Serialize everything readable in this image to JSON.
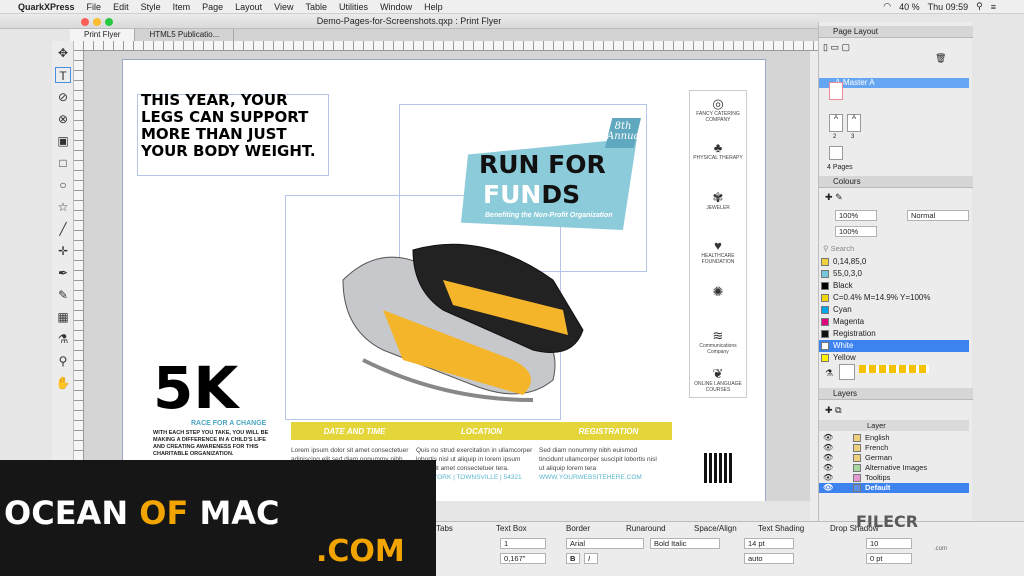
{
  "menubar": {
    "apple": "",
    "app": "QuarkXPress",
    "items": [
      "File",
      "Edit",
      "Style",
      "Item",
      "Page",
      "Layout",
      "View",
      "Table",
      "Utilities",
      "Window",
      "Help"
    ],
    "battery": "40 %",
    "clock": "Thu 09:59"
  },
  "window": {
    "title": "Demo-Pages-for-Screenshots.qxp : Print Flyer"
  },
  "tabs": [
    "Print Flyer",
    "HTML5 Publicatio..."
  ],
  "tools": [
    "move-icon",
    "text-content-icon",
    "text-linking-icon",
    "text-unlinking-icon",
    "picture-content-icon",
    "rectangle-box-icon",
    "oval-box-icon",
    "star-box-icon",
    "line-icon",
    "orthogonal-line-icon",
    "pen-icon",
    "pencil-icon",
    "table-icon",
    "eyedropper-icon",
    "zoom-icon",
    "pan-hand-icon"
  ],
  "flyer": {
    "headline": "THIS YEAR, YOUR\nLEGS CAN SUPPORT\nMORE THAN JUST\nYOUR BODY WEIGHT.",
    "eighth_line1": "8th",
    "eighth_line2": "Annual",
    "run_line1": "RUN FOR",
    "run_fun": "FUN",
    "run_ds": "DS",
    "benefit": "Benefiting the Non-Profit Organization",
    "logos": [
      {
        "glyph": "◎",
        "text": "FANCY CATERING COMPANY"
      },
      {
        "glyph": "♣",
        "text": "PHYSICAL THERAPY"
      },
      {
        "glyph": "✾",
        "text": "JEWELER"
      },
      {
        "glyph": "♥",
        "text": "HEALTHCARE FOUNDATION"
      },
      {
        "glyph": "✺",
        "text": ""
      },
      {
        "glyph": "≋",
        "text": "Communications Company"
      },
      {
        "glyph": "❦",
        "text": "ONLINE LANGUAGE COURSES"
      }
    ],
    "five_k": "5K",
    "race_for_change": "RACE FOR A CHANGE",
    "body_5k": "WITH EACH STEP YOU TAKE, YOU WILL BE MAKING A DIFFERENCE IN A CHILD'S LIFE AND CREATING AWARENESS FOR THIS CHARITABLE ORGANIZATION.",
    "bar_labels": [
      "DATE AND TIME",
      "LOCATION",
      "REGISTRATION"
    ],
    "col1": "Lorem ipsum dolor sit amet consectetuer adipiscing elit sed diam nonummy nibh euismod tincidunt",
    "col2": "Quis no strud exercitation in ullamcorper lobortis nisl ut aliquip in lorem ipsum dolor sit amet consectetuer tera.",
    "col2_acc": "NEW YORK  |  TOWNSVILLE  |  54321",
    "col3": "Sed diam nonummy nibh euismod tincidunt ullamcorper suscipit lobortis nisl ut aliquip lorem tera",
    "col3_acc": "WWW.YOURWEBSITEHERE.COM"
  },
  "page_layout": {
    "title": "Page Layout",
    "master": "A-Master A",
    "pages_label": "4 Pages",
    "page_a": "A",
    "page_2": "2",
    "page_3": "3"
  },
  "colours": {
    "title": "Colours",
    "opacity1": "100%",
    "opacity2": "100%",
    "mode": "Normal",
    "search_placeholder": "Search",
    "items": [
      {
        "name": "0,14,85,0",
        "color": "#f2d23a"
      },
      {
        "name": "55,0,3,0",
        "color": "#76c6dc"
      },
      {
        "name": "Black",
        "color": "#000000"
      },
      {
        "name": "C=0.4% M=14.9% Y=100%",
        "color": "#f4d40a"
      },
      {
        "name": "Cyan",
        "color": "#00a7e8"
      },
      {
        "name": "Magenta",
        "color": "#e0067e"
      },
      {
        "name": "Registration",
        "color": "#111111"
      },
      {
        "name": "White",
        "color": "#ffffff"
      },
      {
        "name": "Yellow",
        "color": "#fff200"
      }
    ]
  },
  "layers": {
    "title": "Layers",
    "header": "Layer",
    "items": [
      {
        "name": "English",
        "color": "#f0d07a"
      },
      {
        "name": "French",
        "color": "#f0d07a"
      },
      {
        "name": "German",
        "color": "#f0d07a"
      },
      {
        "name": "Alternative Images",
        "color": "#a8d8a0"
      },
      {
        "name": "Tooltips",
        "color": "#e69ad4"
      },
      {
        "name": "Default",
        "color": "#5b8fe8"
      }
    ]
  },
  "bottom": {
    "tabs": [
      "Tabs",
      "Text Box",
      "Border",
      "Runaround",
      "Space/Align",
      "Text Shading",
      "Drop Shadow"
    ],
    "columns": "1",
    "gutter": "0,167\"",
    "font": "Arial",
    "style": "Bold Italic",
    "size": "14 pt",
    "leading": "auto",
    "tracking": "10",
    "baseline": "0 pt",
    "bold": "B",
    "italic": "I"
  },
  "watermark": {
    "line1_a": "OCEAN ",
    "line1_b": "OF",
    "line1_c": " MAC",
    "line2": ".COM",
    "filecr": "FILECR",
    "filecr_dom": ".com"
  }
}
